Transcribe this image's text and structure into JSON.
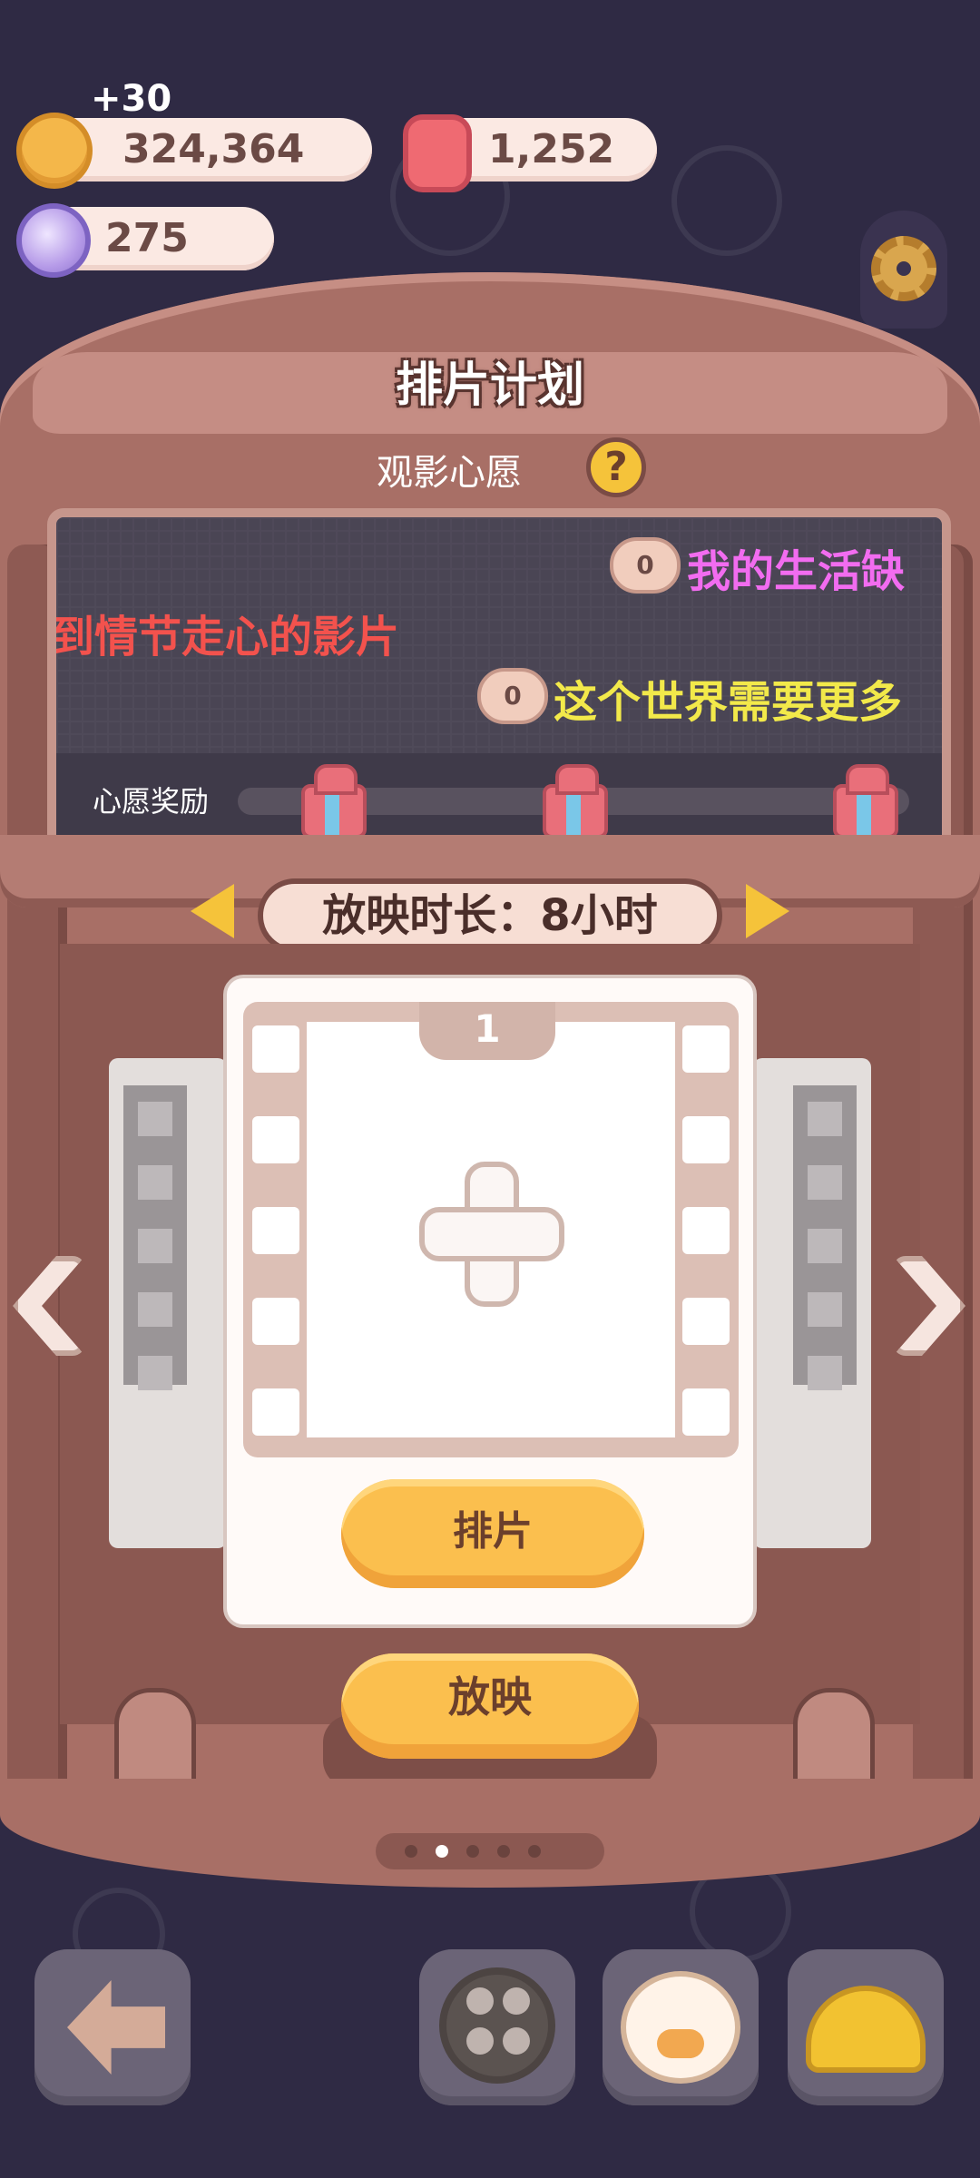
{
  "currency": {
    "bonus": "+30",
    "coins": "324,364",
    "candles": "1,252",
    "gems": "275"
  },
  "panel": {
    "title": "排片计划",
    "wish_title": "观影心愿",
    "help_label": "?"
  },
  "wishes": [
    {
      "count": "0",
      "text": "我的生活缺",
      "color": "#f26cf0"
    },
    {
      "count": "",
      "text": "到情节走心的影片",
      "color": "#f3524d"
    },
    {
      "count": "0",
      "text": "这个世界需要更多",
      "color": "#f2e94a"
    }
  ],
  "reward": {
    "label": "心愿奖励",
    "gifts": [
      "gift-1",
      "gift-2",
      "gift-3"
    ]
  },
  "duration": {
    "text": "放映时长：8小时"
  },
  "slot": {
    "number": "1",
    "schedule_label": "排片"
  },
  "play": {
    "label": "放映"
  },
  "pager": {
    "count": 5,
    "active_index": 1
  },
  "bottom_nav": [
    {
      "icon": "back-arrow-icon"
    },
    {
      "icon": "film-reel-icon"
    },
    {
      "icon": "duck-character-icon"
    },
    {
      "icon": "hard-hat-icon"
    }
  ],
  "colors": {
    "background": "#2f2a44",
    "frame": "#a86f66",
    "accent_button": "#fbbf4e"
  }
}
